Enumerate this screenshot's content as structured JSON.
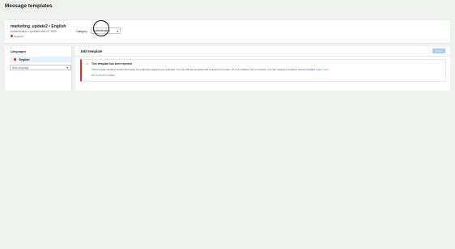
{
  "page": {
    "title": "Message templates"
  },
  "template": {
    "name": "marketing_update2 • English",
    "meta": "Authentication • Updated Mar 21, 2023",
    "status": "Rejected"
  },
  "category": {
    "label": "Category",
    "selected": "Authentication"
  },
  "languages": {
    "title": "Languages",
    "items": [
      {
        "label": "English"
      }
    ],
    "add_placeholder": "Add Language"
  },
  "edit": {
    "title": "Edit template",
    "submit_label": "Submit"
  },
  "alert": {
    "title": "This template has been rejected",
    "body": "This template contains content that does not match the category you selected. You can edit the template and re-submit for review. Or, if you believe this is incorrect, you can request a review in Account Quality.",
    "learn_more": "Learn more",
    "link": "Go to Account Quality"
  },
  "colors": {
    "rejected": "#d93025",
    "link": "#1877f2",
    "selected_bg": "#e7f0fd"
  }
}
